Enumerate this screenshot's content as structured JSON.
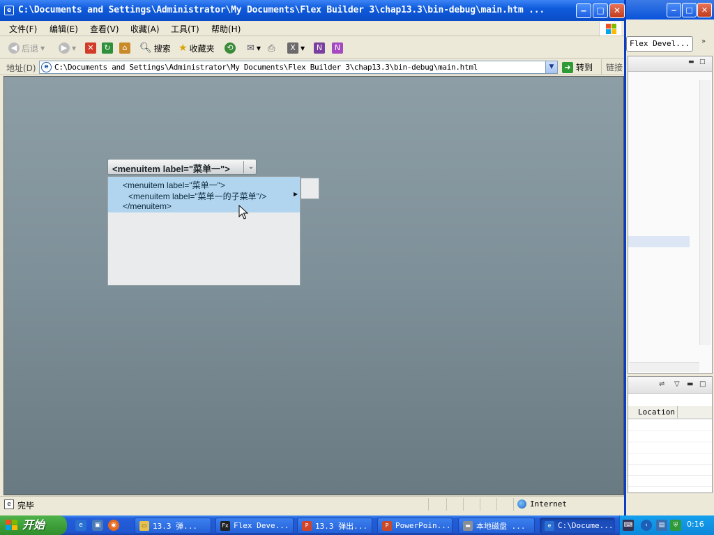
{
  "window": {
    "title": "C:\\Documents and Settings\\Administrator\\My Documents\\Flex Builder 3\\chap13.3\\bin-debug\\main.htm ...",
    "minimize_glyph": "‒",
    "maximize_glyph": "□",
    "close_glyph": "✕"
  },
  "menubar": {
    "items": [
      "文件(F)",
      "编辑(E)",
      "查看(V)",
      "收藏(A)",
      "工具(T)",
      "帮助(H)"
    ]
  },
  "toolbar": {
    "back": "后退",
    "search": "搜索",
    "favorites": "收藏夹"
  },
  "address": {
    "label": "地址(D)",
    "url": "C:\\Documents and Settings\\Administrator\\My Documents\\Flex Builder 3\\chap13.3\\bin-debug\\main.html",
    "go": "转到",
    "links": "链接"
  },
  "app": {
    "popup_button_label": "<menuitem label=\"菜单一\">",
    "menu_lines": [
      "<menuitem label=\"菜单一\">",
      "<menuitem label=\"菜单一的子菜单\"/>",
      "</menuitem>"
    ]
  },
  "statusbar": {
    "text": "完毕",
    "zone": "Internet"
  },
  "ide": {
    "tab_label": "Flex Devel...",
    "column_header": "Location"
  },
  "taskbar": {
    "start": "开始",
    "tasks": [
      "13.3 弹...",
      "Flex Deve...",
      "13.3 弹出...",
      "PowerPoin...",
      "本地磁盘 ...",
      "C:\\Docume..."
    ],
    "clock": "0:16"
  },
  "colors": {
    "titlebar": "#0a4cc7",
    "content_bg": "#7d8f98",
    "menu_selection": "#b2d5ef",
    "taskbar": "#245edb",
    "start_button": "#3a9a35"
  }
}
